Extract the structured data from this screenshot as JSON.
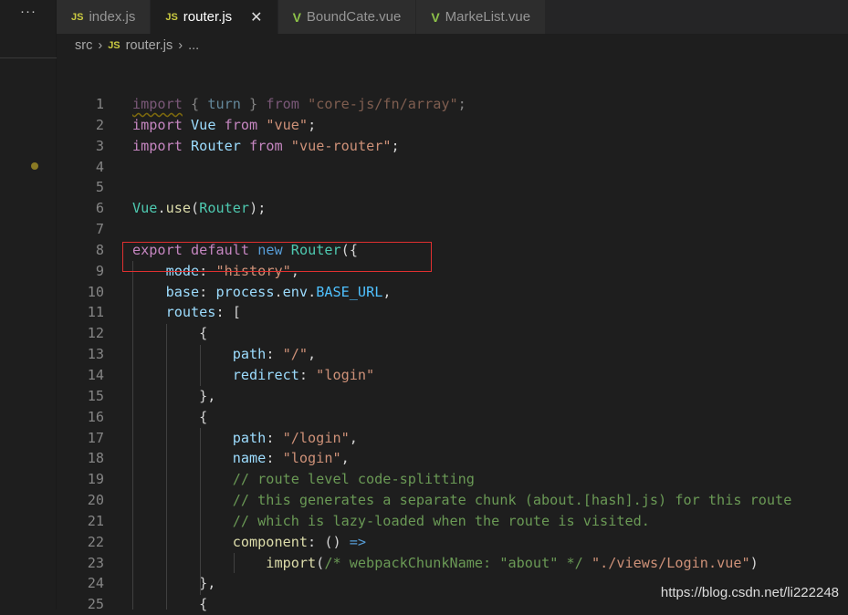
{
  "sidebar": {
    "more_label": "···"
  },
  "tabs": [
    {
      "label": "index.js",
      "icon": "js-icon",
      "active": false
    },
    {
      "label": "router.js",
      "icon": "js-icon",
      "active": true
    },
    {
      "label": "BoundCate.vue",
      "icon": "vue-icon",
      "active": false
    },
    {
      "label": "MarkeList.vue",
      "icon": "vue-icon",
      "active": false
    }
  ],
  "icons": {
    "js": "JS",
    "vue": "V",
    "close": "✕",
    "chevron": "›"
  },
  "breadcrumb": [
    "src",
    "router.js",
    "..."
  ],
  "colors": {
    "keyword": "#c586c0",
    "storage": "#569cd6",
    "variable": "#9cdcfe",
    "class": "#4ec9b0",
    "string": "#ce9178",
    "comment": "#6a9955",
    "function": "#dcdcaa",
    "highlight_box": "#e03030"
  },
  "code": [
    [
      [
        "import",
        "k squig"
      ],
      [
        " { ",
        "p"
      ],
      [
        "turn",
        "v"
      ],
      [
        " } ",
        "p"
      ],
      [
        "from",
        "k"
      ],
      [
        " ",
        "p"
      ],
      [
        "\"core-js/fn/array\"",
        "s"
      ],
      [
        ";",
        "p"
      ]
    ],
    [
      [
        "import",
        "k"
      ],
      [
        " ",
        "p"
      ],
      [
        "Vue",
        "v"
      ],
      [
        " ",
        "p"
      ],
      [
        "from",
        "k"
      ],
      [
        " ",
        "p"
      ],
      [
        "\"vue\"",
        "s"
      ],
      [
        ";",
        "p"
      ]
    ],
    [
      [
        "import",
        "k"
      ],
      [
        " ",
        "p"
      ],
      [
        "Router",
        "v"
      ],
      [
        " ",
        "p"
      ],
      [
        "from",
        "k"
      ],
      [
        " ",
        "p"
      ],
      [
        "\"vue-router\"",
        "s"
      ],
      [
        ";",
        "p"
      ]
    ],
    [],
    [],
    [
      [
        "Vue",
        "c"
      ],
      [
        ".",
        "p"
      ],
      [
        "use",
        "f"
      ],
      [
        "(",
        "p"
      ],
      [
        "Router",
        "c"
      ],
      [
        ");",
        "p"
      ]
    ],
    [],
    [
      [
        "export",
        "k"
      ],
      [
        " ",
        "p"
      ],
      [
        "default",
        "k"
      ],
      [
        " ",
        "p"
      ],
      [
        "new",
        "b"
      ],
      [
        " ",
        "p"
      ],
      [
        "Router",
        "c"
      ],
      [
        "({",
        "p"
      ]
    ],
    [
      [
        "    mode",
        "v"
      ],
      [
        ": ",
        "p"
      ],
      [
        "\"history\"",
        "s"
      ],
      [
        ",",
        "p"
      ]
    ],
    [
      [
        "    base",
        "v"
      ],
      [
        ": ",
        "p"
      ],
      [
        "process",
        "v"
      ],
      [
        ".",
        "p"
      ],
      [
        "env",
        "v"
      ],
      [
        ".",
        "p"
      ],
      [
        "BASE_URL",
        "cst"
      ],
      [
        ",",
        "p"
      ]
    ],
    [
      [
        "    routes",
        "v"
      ],
      [
        ": [",
        "p"
      ]
    ],
    [
      [
        "        {",
        "p"
      ]
    ],
    [
      [
        "            path",
        "v"
      ],
      [
        ": ",
        "p"
      ],
      [
        "\"/\"",
        "s"
      ],
      [
        ",",
        "p"
      ]
    ],
    [
      [
        "            redirect",
        "v"
      ],
      [
        ": ",
        "p"
      ],
      [
        "\"login\"",
        "s"
      ]
    ],
    [
      [
        "        },",
        "p"
      ]
    ],
    [
      [
        "        {",
        "p"
      ]
    ],
    [
      [
        "            path",
        "v"
      ],
      [
        ": ",
        "p"
      ],
      [
        "\"/login\"",
        "s"
      ],
      [
        ",",
        "p"
      ]
    ],
    [
      [
        "            name",
        "v"
      ],
      [
        ": ",
        "p"
      ],
      [
        "\"login\"",
        "s"
      ],
      [
        ",",
        "p"
      ]
    ],
    [
      [
        "            // route level code-splitting",
        "m"
      ]
    ],
    [
      [
        "            // this generates a separate chunk (about.[hash].js) for this route",
        "m"
      ]
    ],
    [
      [
        "            // which is lazy-loaded when the route is visited.",
        "m"
      ]
    ],
    [
      [
        "            component",
        "f"
      ],
      [
        ": () ",
        "p"
      ],
      [
        "=>",
        "b"
      ]
    ],
    [
      [
        "                import",
        "f"
      ],
      [
        "(",
        "p"
      ],
      [
        "/* webpackChunkName: \"about\" */",
        "m"
      ],
      [
        " ",
        "p"
      ],
      [
        "\"./views/Login.vue\"",
        "s"
      ],
      [
        ")",
        "p"
      ]
    ],
    [
      [
        "        },",
        "p"
      ]
    ],
    [
      [
        "        {",
        "p"
      ]
    ]
  ],
  "watermark": "https://blog.csdn.net/li222248"
}
